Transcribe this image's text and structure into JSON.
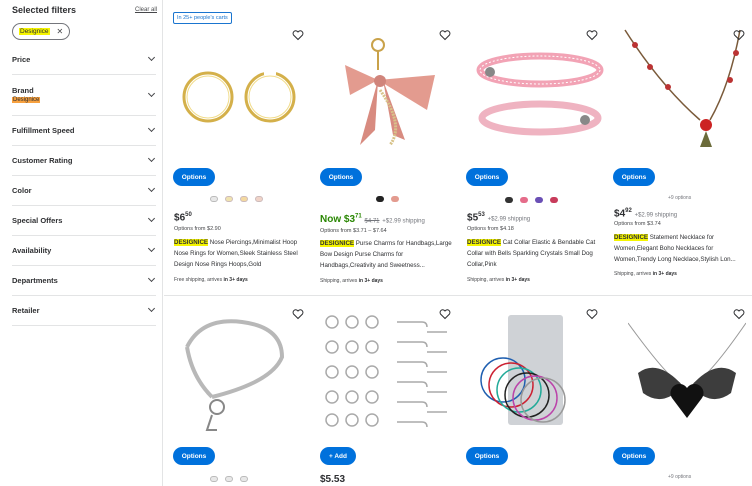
{
  "sidebar": {
    "title": "Selected filters",
    "clear": "Clear all",
    "chip": "Designice",
    "filters": [
      {
        "label": "Price"
      },
      {
        "label": "Brand",
        "sub": "Designice"
      },
      {
        "label": "Fulfillment Speed"
      },
      {
        "label": "Customer Rating"
      },
      {
        "label": "Color"
      },
      {
        "label": "Special Offers"
      },
      {
        "label": "Availability"
      },
      {
        "label": "Departments"
      },
      {
        "label": "Retailer"
      }
    ]
  },
  "badge": "In 25+ people's carts",
  "products": [
    {
      "button": "Options",
      "price_dollars": "6",
      "price_cents": "50",
      "options_from": "Options from $2.90",
      "brand": "DESIGNICE",
      "title": " Nose Piercings,Minimalist Hoop Nose Rings for Women,Sleek Stainless Steel Design Nose Rings Hoops,Gold",
      "shipping": "Free shipping, arrives ",
      "shipping_bold": "in 3+ days"
    },
    {
      "button": "Options",
      "now": "Now ",
      "price_dollars": "3",
      "price_cents": "71",
      "was": "$4.71",
      "ship_fee": "+$2.99 shipping",
      "options_from": "Options from $3.71 – $7.64",
      "brand": "DESIGNICE",
      "title": " Purse Charms for Handbags,Large Bow Design Purse Charms for Handbags,Creativity and Sweetness...",
      "shipping": "Shipping, arrives ",
      "shipping_bold": "in 3+ days"
    },
    {
      "button": "Options",
      "price_dollars": "5",
      "price_cents": "53",
      "ship_fee": "+$2.99 shipping",
      "options_from": "Options from $4.18",
      "brand": "DESIGNICE",
      "title": " Cat Collar Elastic & Bendable Cat Collar with Bells Sparkling Crystals Small Dog Collar,Pink",
      "shipping": "Shipping, arrives ",
      "shipping_bold": "in 3+ days"
    },
    {
      "button": "Options",
      "more": "+9 options",
      "price_dollars": "4",
      "price_cents": "92",
      "ship_fee": "+$2.99 shipping",
      "options_from": "Options from $3.74",
      "brand": "DESIGNICE",
      "title": " Statement Necklace for Women,Elegant Boho Necklaces for Women,Trendy Long Necklace,Stylish Lon...",
      "shipping": "Shipping, arrives ",
      "shipping_bold": "in 3+ days"
    }
  ],
  "row2_buttons": [
    "Options",
    "+ Add",
    "Options",
    "Options"
  ],
  "row2_price_partial": "$5.53",
  "row2_more": "+9 options",
  "colors": {
    "accent": "#0071dc",
    "highlight": "#f5f500",
    "brand_orange": "#f7a13f",
    "now_green": "#2a8703"
  }
}
